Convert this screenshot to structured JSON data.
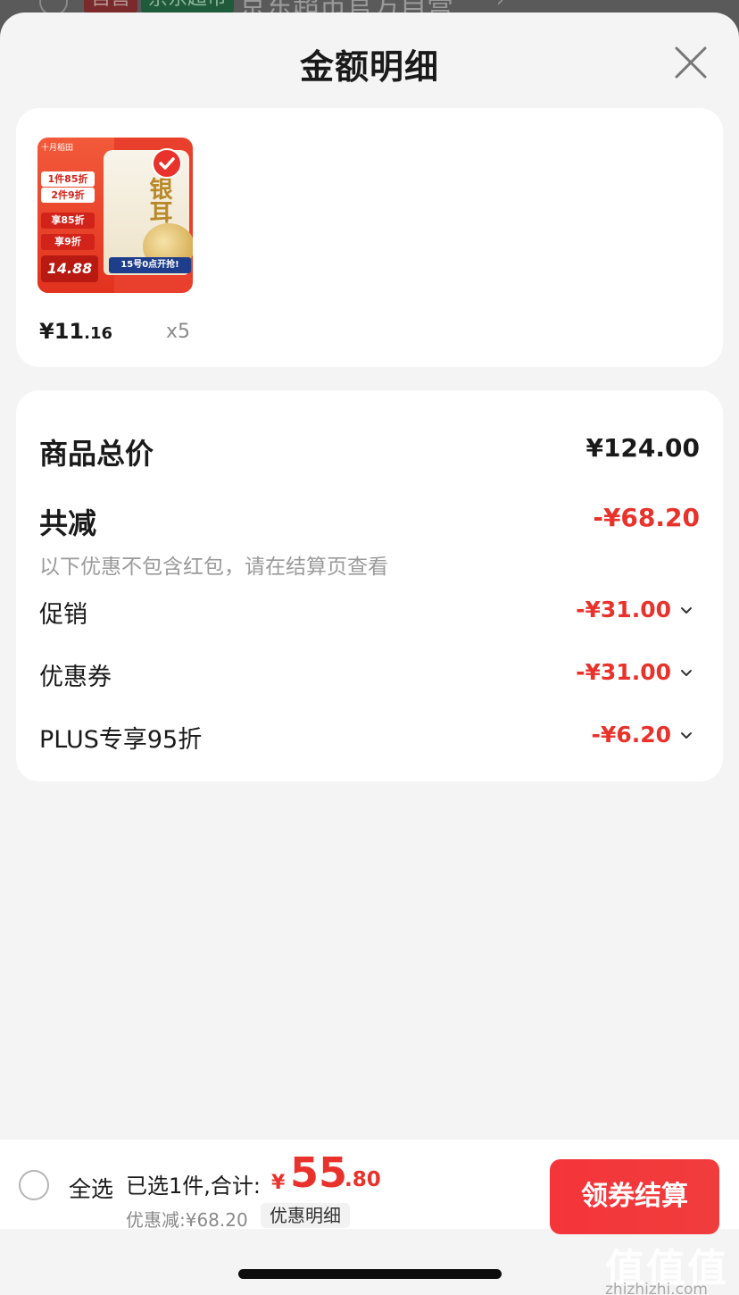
{
  "background_page": {
    "tag_self": "自营",
    "tag_supermarket": "京东超市",
    "shop_name": "京东超市官方自营",
    "chevron": "›"
  },
  "sheet": {
    "title": "金额明细",
    "close_icon": "close-icon"
  },
  "product": {
    "thumbnail": {
      "brand": "十月稻田",
      "promo_1": "1件85折",
      "promo_2": "2件9折",
      "deal_1": "享85折",
      "deal_2": "享9折",
      "price": "14.88",
      "bag_title": "银耳",
      "launch": "15号0点开抢!",
      "selected_icon": "check-icon"
    },
    "unit_price_symbol": "¥",
    "unit_price_int": "11",
    "unit_price_dec": ".16",
    "quantity": "x5"
  },
  "summary": {
    "total_label": "商品总价",
    "total_value": "¥124.00",
    "reduce_label": "共减",
    "reduce_value": "-¥68.20",
    "note": "以下优惠不包含红包，请在结算页查看",
    "rows": [
      {
        "label": "促销",
        "value": "-¥31.00"
      },
      {
        "label": "优惠券",
        "value": "-¥31.00"
      },
      {
        "label": "PLUS专享95折",
        "value": "-¥6.20"
      }
    ]
  },
  "bottom_bar": {
    "select_all": "全选",
    "selected_text": "已选1件,合计:",
    "total_yen": "¥",
    "total_int": "55",
    "total_dec": ".80",
    "discount_text": "优惠减:¥68.20",
    "discount_detail": "优惠明细",
    "checkout": "领券结算"
  },
  "watermark": {
    "mark": "值值值",
    "url": "zhizhizhi.com"
  },
  "colors": {
    "accent_red": "#e8322b",
    "sheet_bg": "#f4f4f4",
    "card_bg": "#ffffff"
  }
}
